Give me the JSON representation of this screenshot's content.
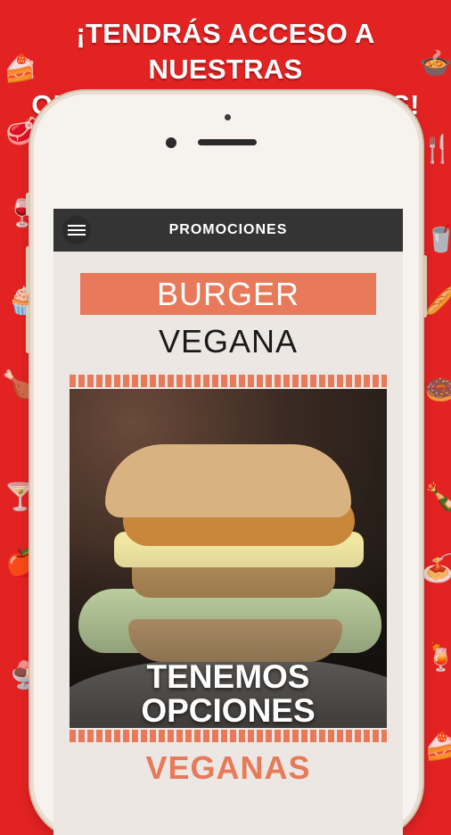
{
  "headline": {
    "line1": "¡TENDRÁS ACCESO A NUESTRAS",
    "line2": "OFERTAS Y PROMOCIONES!"
  },
  "app": {
    "title": "PROMOCIONES",
    "menu_icon": "hamburger-menu-icon"
  },
  "promo": {
    "label_top": "BURGER",
    "label_bottom": "VEGANA",
    "image_description": "veggie burger photo",
    "overlay_line1": "TENEMOS",
    "overlay_line2": "OPCIONES",
    "footer_word": "VEGANAS"
  },
  "colors": {
    "background": "#e32322",
    "accent": "#e8795a",
    "appbar": "#343434"
  }
}
